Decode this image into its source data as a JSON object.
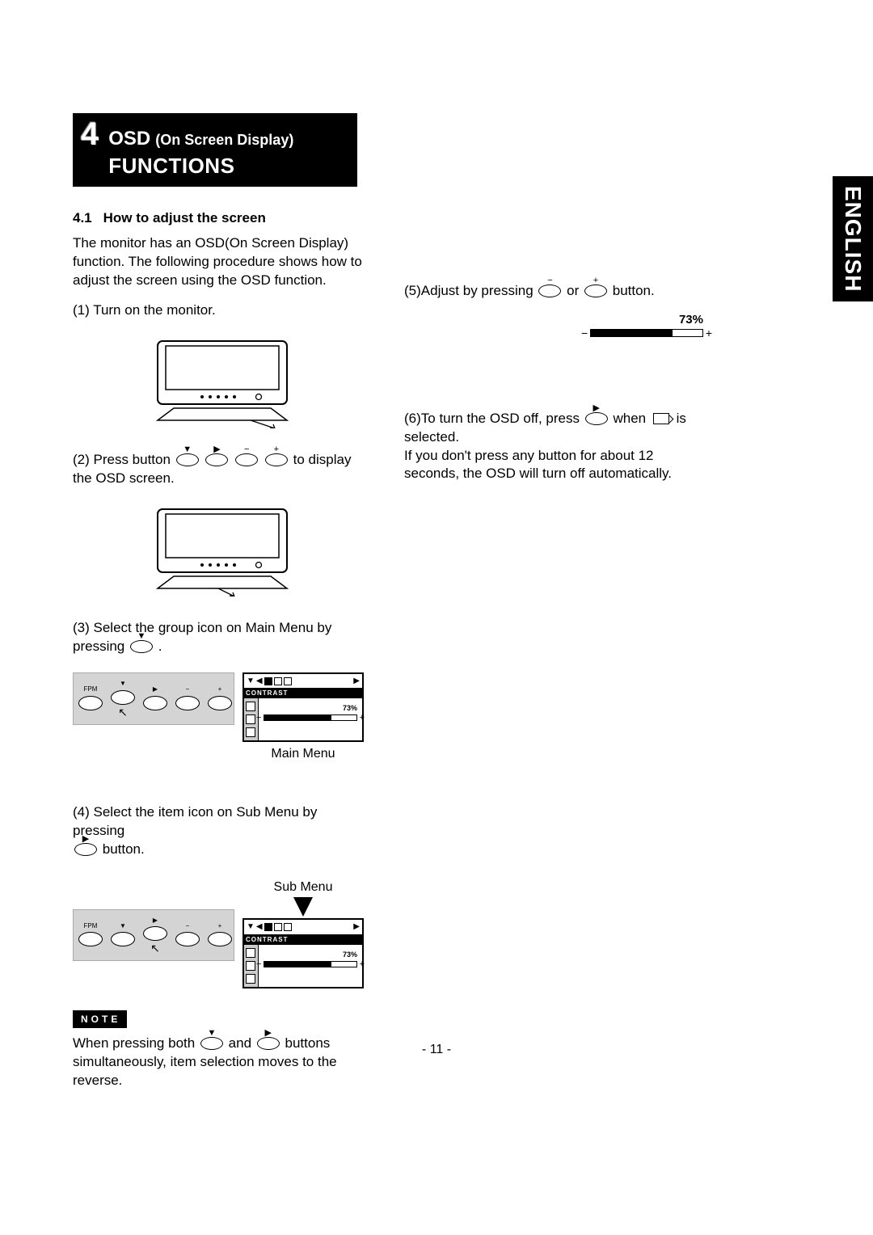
{
  "language_tab": "ENGLISH",
  "section": {
    "number": "4",
    "title_main": "OSD",
    "title_paren": "(On Screen Display)",
    "title_sub": "FUNCTIONS"
  },
  "subsection": {
    "number": "4.1",
    "title": "How to adjust the screen"
  },
  "intro": "The monitor has an OSD(On Screen Display) function. The following procedure shows how to adjust the screen using the OSD function.",
  "steps": {
    "s1": "(1) Turn on the monitor.",
    "s2_a": "(2) Press button",
    "s2_b": "to display the OSD screen.",
    "s3_a": "(3) Select the group icon on Main Menu by pressing",
    "s3_b": ".",
    "s4_a": "(4) Select the item icon on Sub Menu by pressing",
    "s4_b": "button.",
    "s5_a": "(5)Adjust by pressing",
    "s5_mid": "or",
    "s5_b": "button.",
    "s6_a": "(6)To turn the OSD off, press",
    "s6_mid": "when",
    "s6_b": "is selected.",
    "s6_tail": "If you don't press any button for about 12 seconds, the OSD will turn off automatically."
  },
  "captions": {
    "main_menu": "Main Menu",
    "sub_menu": "Sub Menu"
  },
  "button_strip": {
    "labels": [
      "FPM",
      "▼",
      "▶",
      "−",
      "+"
    ]
  },
  "osd": {
    "title": "CONTRAST",
    "value": "73%",
    "bar_pct": 73,
    "topbar_marks": [
      "▼",
      "◀",
      "▶"
    ]
  },
  "progress": {
    "value": "73%",
    "pct": 73
  },
  "note": {
    "label": "NOTE",
    "text_a": "When pressing both",
    "text_mid": "and",
    "text_b": "buttons simultaneously, item selection moves to the reverse."
  },
  "footer": "- 11 -"
}
